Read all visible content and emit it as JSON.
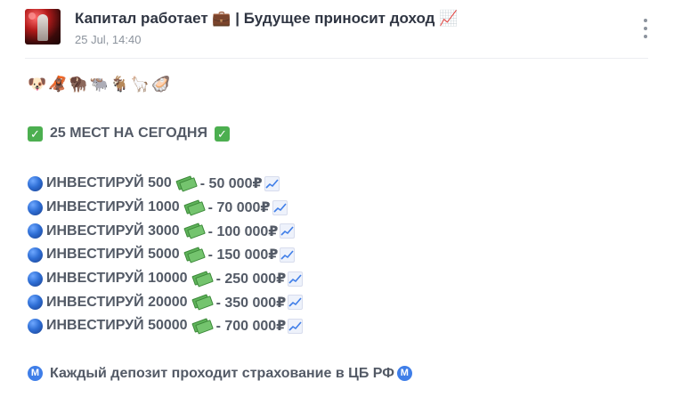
{
  "header": {
    "channel_title": "Капитал работает 💼 | Будущее приносит доход 📈",
    "date": "25 Jul, 14:40"
  },
  "post": {
    "emoji_row": "🐶🦧🦬🐃🐐🦙🦪",
    "headline": "25 МЕСТ НА СЕГОДНЯ",
    "offers": [
      {
        "invest": "ИНВЕСТИРУЙ 500",
        "payout": "- 50 000₽"
      },
      {
        "invest": "ИНВЕСТИРУЙ 1000",
        "payout": "- 70 000₽"
      },
      {
        "invest": "ИНВЕСТИРУЙ 3000",
        "payout": "- 100 000₽"
      },
      {
        "invest": "ИНВЕСТИРУЙ 5000",
        "payout": "- 150 000₽"
      },
      {
        "invest": "ИНВЕСТИРУЙ 10000",
        "payout": "- 250 000₽"
      },
      {
        "invest": "ИНВЕСТИРУЙ 20000",
        "payout": "- 350 000₽"
      },
      {
        "invest": "ИНВЕСТИРУЙ 50000",
        "payout": "- 700 000₽"
      }
    ],
    "footer": "Каждый депозит проходит страхование в ЦБ РФ",
    "metro_letter": "M"
  },
  "icons": {
    "check": "✓",
    "menu": "more-vertical-icon",
    "offer_bullet": "blue-circle-icon",
    "cash": "money-with-wings-icon",
    "chart": "chart-increasing-icon"
  },
  "colors": {
    "check_green": "#4caf50",
    "metro_blue": "#3f7ee8",
    "text": "#535a66",
    "muted": "#8c939d"
  }
}
